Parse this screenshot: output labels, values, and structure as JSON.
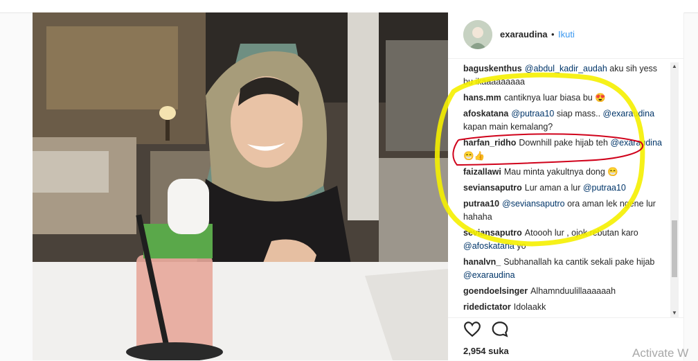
{
  "post": {
    "username": "exaraudina",
    "separator": "•",
    "follow_label": "Ikuti",
    "likes": "2,954 suka"
  },
  "comments": [
    {
      "user": "baguskenthus",
      "parts": [
        {
          "m": "@abdul_kadir_audah"
        },
        {
          "t": " aku sih yess bu ikaaaaaaaaa"
        }
      ]
    },
    {
      "user": "hans.mm",
      "parts": [
        {
          "t": "cantiknya luar biasa bu 😍"
        }
      ]
    },
    {
      "user": "afoskatana",
      "parts": [
        {
          "m": "@putraa10"
        },
        {
          "t": " siap mass.. "
        },
        {
          "m": "@exaraudina"
        },
        {
          "t": " kapan main kemalang?"
        }
      ]
    },
    {
      "user": "harfan_ridho",
      "parts": [
        {
          "t": "Downhill pake hijab teh "
        },
        {
          "m": "@exaraudina"
        },
        {
          "t": " 😁👍"
        }
      ]
    },
    {
      "user": "faizallawi",
      "parts": [
        {
          "t": "Mau minta yakultnya dong 😁"
        }
      ]
    },
    {
      "user": "seviansaputro",
      "parts": [
        {
          "t": "Lur aman a lur "
        },
        {
          "m": "@putraa10"
        }
      ]
    },
    {
      "user": "putraa10",
      "parts": [
        {
          "m": "@seviansaputro"
        },
        {
          "t": " ora aman lek ngene lur hahaha"
        }
      ]
    },
    {
      "user": "seviansaputro",
      "parts": [
        {
          "t": "Atoooh lur , ojok rebutan karo "
        },
        {
          "m": "@afoskatana"
        },
        {
          "t": " yo"
        }
      ]
    },
    {
      "user": "hanalvn_",
      "parts": [
        {
          "t": "Subhanallah ka cantik sekali pake hijab "
        },
        {
          "m": "@exaraudina"
        }
      ]
    },
    {
      "user": "goendoelsinger",
      "parts": [
        {
          "t": "Alhamnduulillaaaaaah"
        }
      ]
    },
    {
      "user": "ridedictator",
      "parts": [
        {
          "t": "Idolaakk"
        }
      ]
    }
  ],
  "icons": {
    "like": "heart-outline-icon",
    "comment": "speech-bubble-icon",
    "scroll_up": "▲",
    "scroll_down": "▼"
  },
  "colors": {
    "mention": "#003569",
    "follow": "#3897f0",
    "highlight_circle": "#f5f000",
    "underline_mark": "#d0021b"
  },
  "watermark": "Activate W"
}
